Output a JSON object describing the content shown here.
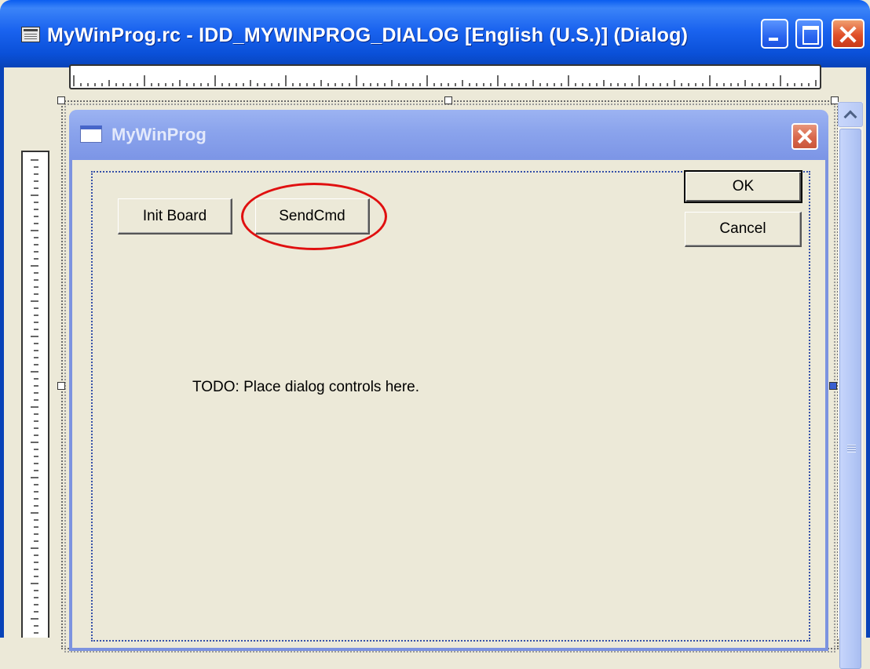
{
  "window": {
    "title": "MyWinProg.rc - IDD_MYWINPROG_DIALOG [English (U.S.)] (Dialog)"
  },
  "dialog": {
    "title": "MyWinProg",
    "buttons": {
      "init_board": "Init Board",
      "send_cmd": "SendCmd",
      "ok": "OK",
      "cancel": "Cancel"
    },
    "placeholder_text": "TODO: Place dialog controls here."
  },
  "annotation": {
    "highlight_color": "#e01010",
    "highlighted_control": "SendCmd"
  },
  "colors": {
    "xp_title_blue": "#1a63ef",
    "dialog_title_blue": "#8aa3ec",
    "dialog_face": "#ece9d8"
  }
}
